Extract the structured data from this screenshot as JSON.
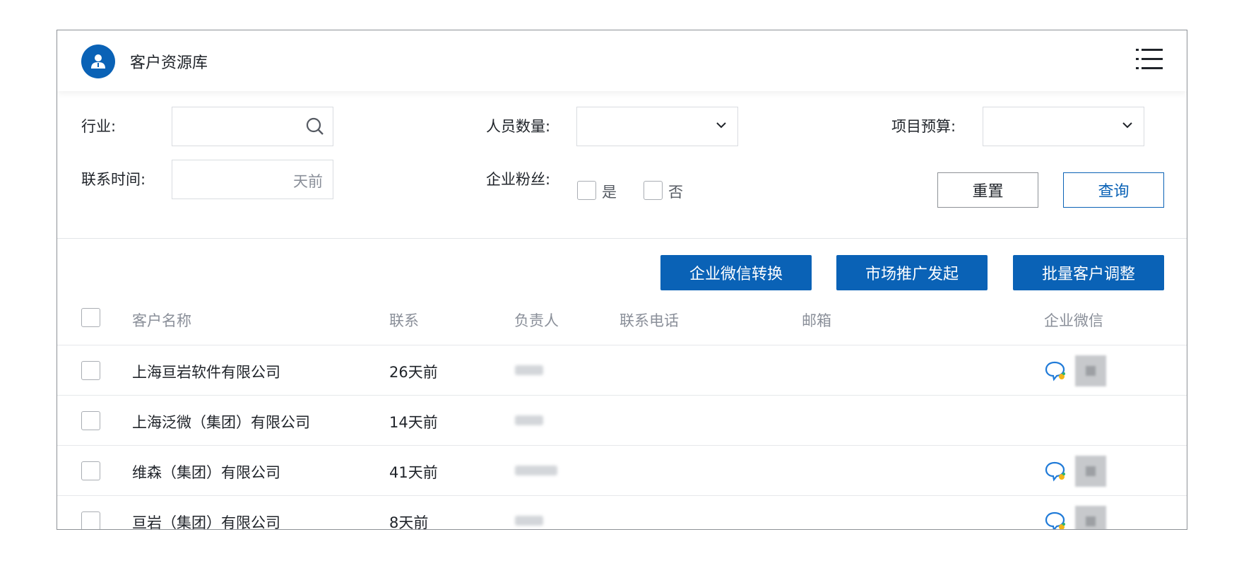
{
  "header": {
    "title": "客户资源库",
    "app_icon": "user-icon",
    "menu_icon": "list-menu-icon"
  },
  "filters": {
    "industry": {
      "label": "行业:",
      "value": ""
    },
    "staff_count": {
      "label": "人员数量:",
      "value": ""
    },
    "budget": {
      "label": "项目预算:",
      "value": ""
    },
    "contact_time": {
      "label": "联系时间:",
      "suffix": "天前"
    },
    "fans": {
      "label": "企业粉丝:",
      "yes": "是",
      "no": "否"
    },
    "reset_label": "重置",
    "search_label": "查询"
  },
  "actions": {
    "wechat_convert": "企业微信转换",
    "marketing": "市场推广发起",
    "batch_adjust": "批量客户调整"
  },
  "table": {
    "columns": {
      "name": "客户名称",
      "contact": "联系",
      "owner": "负责人",
      "phone": "联系电话",
      "email": "邮箱",
      "wechat": "企业微信"
    },
    "rows": [
      {
        "name": "上海亘岩软件有限公司",
        "contact": "26天前"
      },
      {
        "name": "上海泛微（集团）有限公司",
        "contact": "14天前"
      },
      {
        "name": "维森（集团）有限公司",
        "contact": "41天前"
      },
      {
        "name": "亘岩（集团）有限公司",
        "contact": "8天前"
      }
    ]
  },
  "colors": {
    "primary": "#0a62b6",
    "border": "#d9dce0",
    "muted": "#8a8f99"
  }
}
